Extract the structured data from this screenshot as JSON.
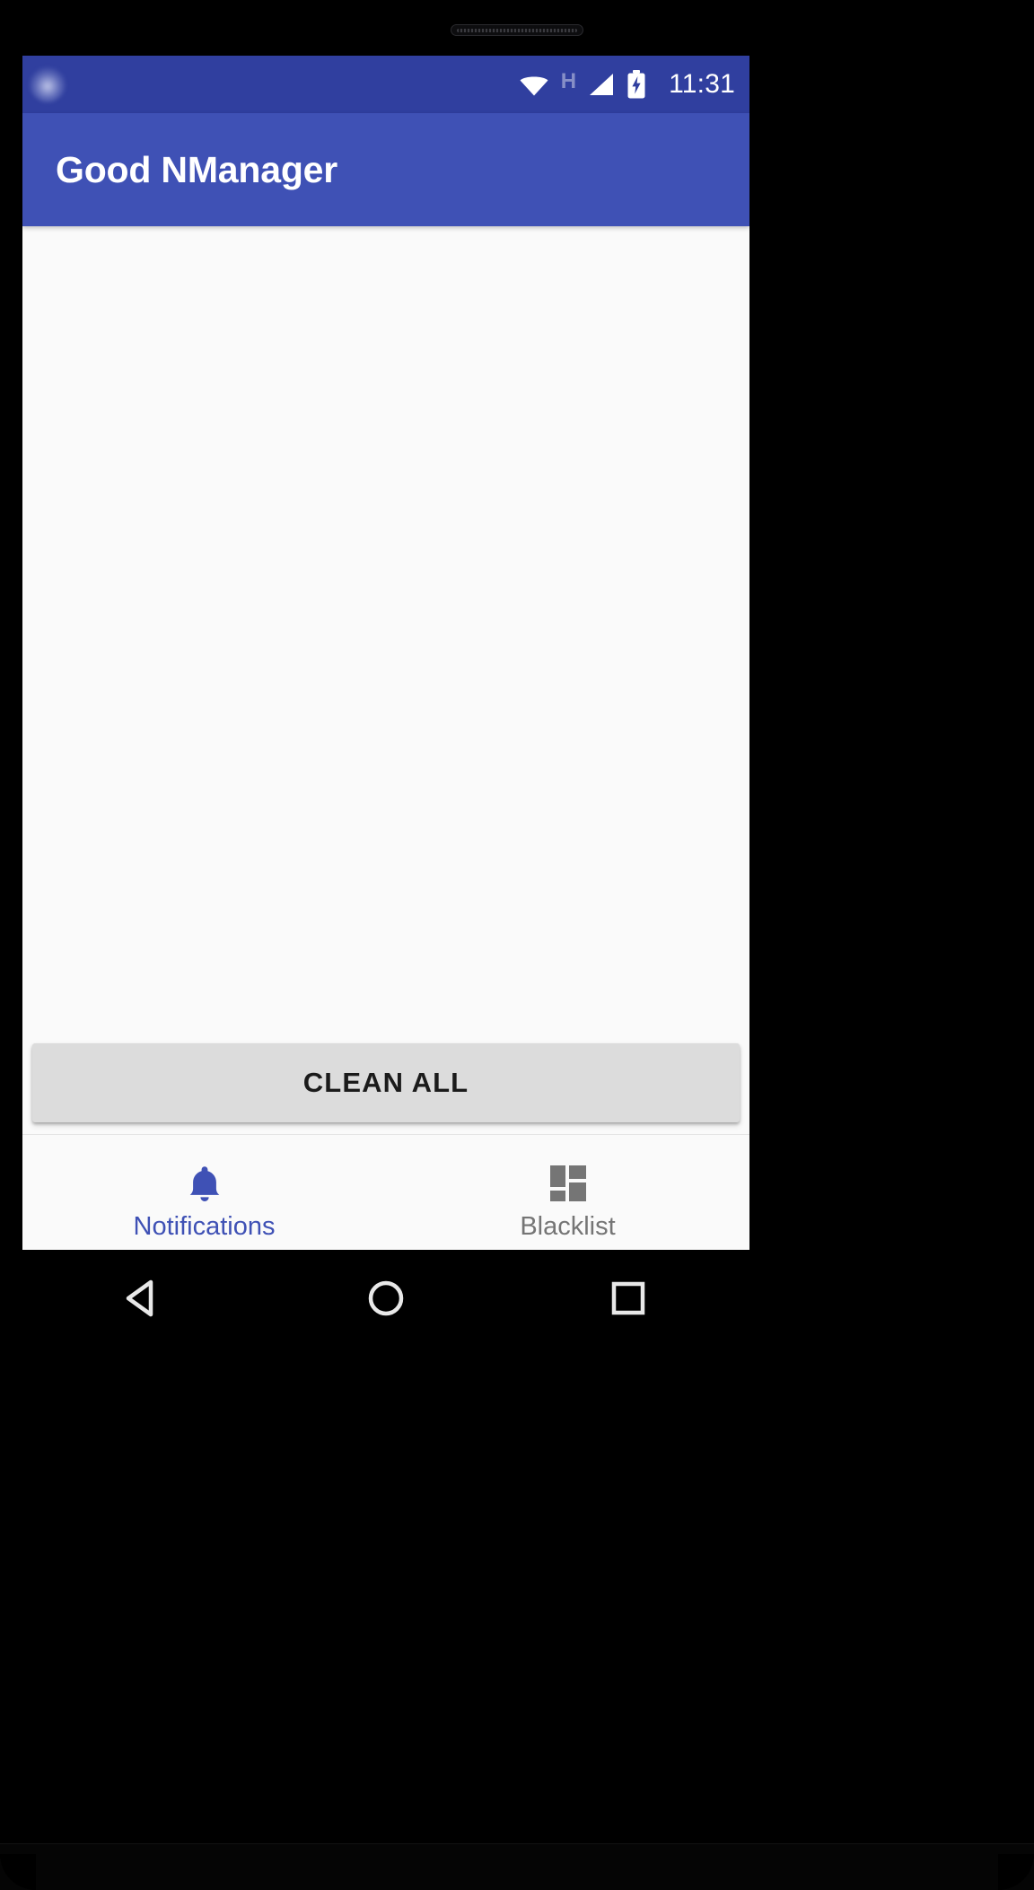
{
  "app": {
    "title": "Good NManager"
  },
  "status_bar": {
    "time": "11:31",
    "network_type": "H",
    "icons": [
      "notification-dot-icon",
      "wifi-icon",
      "network-h-icon",
      "cellular-signal-icon",
      "battery-charging-icon"
    ],
    "background_color": "#303F9F"
  },
  "appbar": {
    "background_color": "#3F51B5",
    "text_color": "#FFFFFF"
  },
  "content": {
    "notifications": [],
    "empty": true,
    "background_color": "#FAFAFA"
  },
  "actions": {
    "clean_all_label": "CLEAN ALL",
    "clean_all_bg": "#DCDCDC"
  },
  "bottom_nav": {
    "active_color": "#3F51B5",
    "inactive_color": "#757575",
    "items": [
      {
        "label": "Notifications",
        "icon": "bell-icon",
        "active": true
      },
      {
        "label": "Blacklist",
        "icon": "dashboard-grid-icon",
        "active": false
      }
    ]
  },
  "system_nav": {
    "buttons": [
      {
        "name": "back",
        "icon": "back-triangle-icon"
      },
      {
        "name": "home",
        "icon": "home-circle-icon"
      },
      {
        "name": "recents",
        "icon": "recents-square-icon"
      }
    ]
  }
}
